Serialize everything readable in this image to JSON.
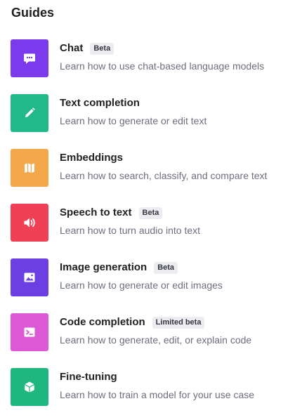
{
  "section": {
    "title": "Guides"
  },
  "guides": [
    {
      "title": "Chat",
      "badge": "Beta",
      "description": "Learn how to use chat-based language models",
      "color": "#7b3aec",
      "icon": "chat-bubble-icon"
    },
    {
      "title": "Text completion",
      "badge": "",
      "description": "Learn how to generate or edit text",
      "color": "#21b88a",
      "icon": "pencil-icon"
    },
    {
      "title": "Embeddings",
      "badge": "",
      "description": "Learn how to search, classify, and compare text",
      "color": "#f4a84b",
      "icon": "map-icon"
    },
    {
      "title": "Speech to text",
      "badge": "Beta",
      "description": "Learn how to turn audio into text",
      "color": "#ef4056",
      "icon": "speaker-icon"
    },
    {
      "title": "Image generation",
      "badge": "Beta",
      "description": "Learn how to generate or edit images",
      "color": "#6c3fe3",
      "icon": "image-icon"
    },
    {
      "title": "Code completion",
      "badge": "Limited beta",
      "description": "Learn how to generate, edit, or explain code",
      "color": "#dd58d6",
      "icon": "terminal-icon"
    },
    {
      "title": "Fine-tuning",
      "badge": "",
      "description": "Learn how to train a model for your use case",
      "color": "#1fb680",
      "icon": "cube-icon"
    }
  ]
}
